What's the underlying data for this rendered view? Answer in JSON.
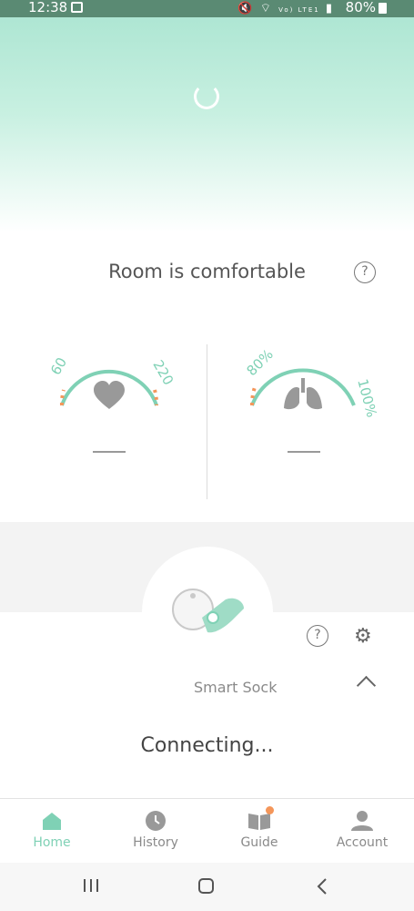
{
  "status_bar": {
    "time": "12:38",
    "network": "Vo) LTE1",
    "battery": "80%"
  },
  "room": {
    "status_text": "Room is comfortable"
  },
  "heart_gauge": {
    "min_label": "60",
    "max_label": "220",
    "value_text": "—"
  },
  "oxygen_gauge": {
    "min_label": "80%",
    "max_label": "100%",
    "value_text": "—"
  },
  "device": {
    "name": "Smart Sock",
    "connection_status": "Connecting..."
  },
  "nav": {
    "items": [
      {
        "label": "Home",
        "icon": "home-icon",
        "active": true
      },
      {
        "label": "History",
        "icon": "clock-icon",
        "active": false
      },
      {
        "label": "Guide",
        "icon": "book-icon",
        "active": false
      },
      {
        "label": "Account",
        "icon": "person-icon",
        "active": false
      }
    ]
  },
  "colors": {
    "accent": "#7fd1b5",
    "warning": "#f4965a",
    "icon_gray": "#999999"
  }
}
